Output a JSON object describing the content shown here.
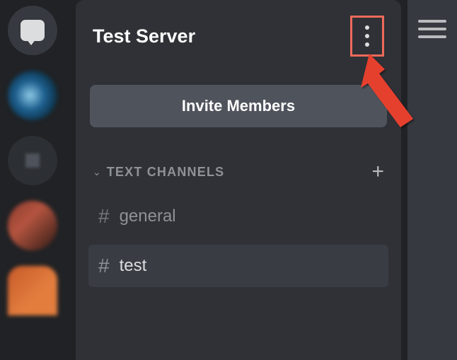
{
  "server": {
    "name": "Test Server",
    "invite_label": "Invite Members"
  },
  "sections": {
    "text_channels_label": "TEXT CHANNELS"
  },
  "channels": [
    {
      "name": "general",
      "active": false
    },
    {
      "name": "test",
      "active": true
    }
  ],
  "colors": {
    "highlight": "#ef6a5a",
    "panel": "#2f3136",
    "rail": "#202225"
  }
}
